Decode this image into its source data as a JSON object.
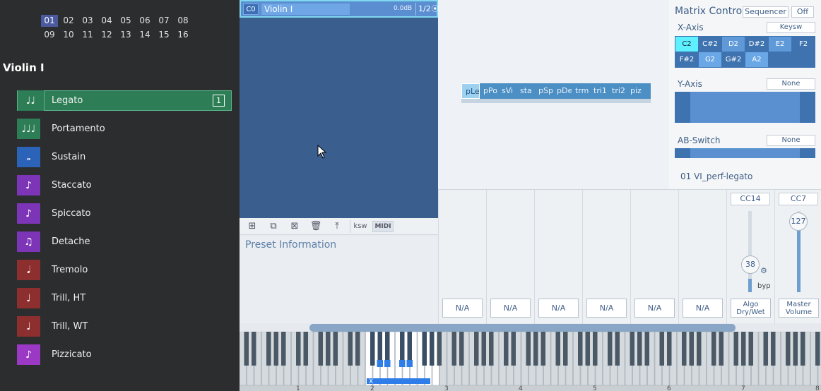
{
  "channels": [
    "01",
    "02",
    "03",
    "04",
    "05",
    "06",
    "07",
    "08",
    "09",
    "10",
    "11",
    "12",
    "13",
    "14",
    "15",
    "16"
  ],
  "selected_channel": "01",
  "instrument_title": "Violin I",
  "articulations": [
    {
      "label": "Legato",
      "icon": "note-legato-icon",
      "color": "#2d7d56",
      "number": "1"
    },
    {
      "label": "Portamento",
      "icon": "note-portamento-icon",
      "color": "#2d7d56"
    },
    {
      "label": "Sustain",
      "icon": "whole-note-icon",
      "color": "#2b63b8"
    },
    {
      "label": "Staccato",
      "icon": "note-staccato-icon",
      "color": "#7d35b8"
    },
    {
      "label": "Spiccato",
      "icon": "note-spiccato-icon",
      "color": "#7d35b8"
    },
    {
      "label": "Detache",
      "icon": "note-detache-icon",
      "color": "#7d35b8"
    },
    {
      "label": "Tremolo",
      "icon": "note-tremolo-icon",
      "color": "#8e2f2f"
    },
    {
      "label": "Trill, HT",
      "icon": "note-trill-icon",
      "color": "#8e2f2f"
    },
    {
      "label": "Trill, WT",
      "icon": "note-trill-icon",
      "color": "#8e2f2f"
    },
    {
      "label": "Pizzicato",
      "icon": "note-pizzicato-icon",
      "color": "#9b38c4"
    }
  ],
  "instrument_header": {
    "slot": "C0",
    "name": "Violin I",
    "level": "0.0dB",
    "page": "1/2"
  },
  "toolbar": {
    "ksw": "ksw",
    "midi": "MIDI"
  },
  "preset_info_title": "Preset Information",
  "art_strip": [
    "pLeg",
    "pPo",
    "sVi",
    "sta",
    "pSp",
    "pDe",
    "trm",
    "tri1",
    "tri2",
    "piz"
  ],
  "art_strip_selected": "pLeg",
  "matrix": {
    "title": "Matrix Control",
    "sequencer": "Sequencer",
    "off": "Off",
    "x_axis": "X-Axis",
    "x_axis_value": "Keysw",
    "keys_row1": [
      "C2",
      "C#2",
      "D2",
      "D#2",
      "E2",
      "F2"
    ],
    "keys_row2": [
      "F#2",
      "G2",
      "G#2",
      "A2",
      "",
      ""
    ],
    "y_axis": "Y-Axis",
    "y_axis_value": "None",
    "ab_switch": "AB-Switch",
    "ab_switch_value": "None",
    "patch": "01 VI_perf-legato"
  },
  "mixer": {
    "slots": [
      "N/A",
      "N/A",
      "N/A",
      "N/A",
      "N/A",
      "N/A"
    ],
    "cc14": "CC14",
    "cc7": "CC7",
    "algo_value": "38",
    "algo_bypass": "byp",
    "algo_label": "Algo Dry/Wet",
    "volume_value": "127",
    "volume_label": "Master Volume"
  },
  "keyboard_octaves": [
    "1",
    "2",
    "3",
    "4",
    "5",
    "6",
    "7",
    "8"
  ],
  "keyboard_marker": "X"
}
